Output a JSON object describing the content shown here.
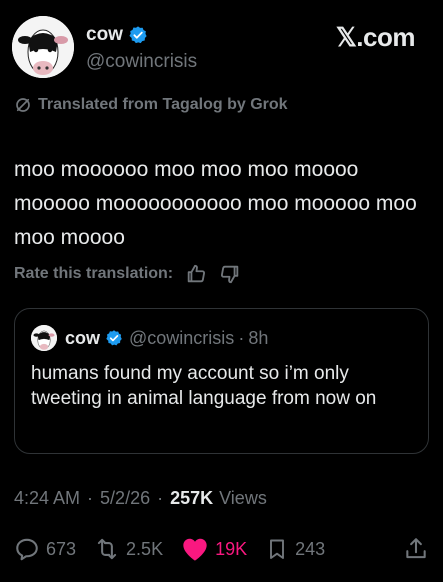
{
  "author": {
    "name": "cow",
    "handle": "@cowincrisis"
  },
  "brand": "𝕏.com",
  "translation_note": "Translated from Tagalog by Grok",
  "tweet_text": "moo moooooo moo moo moo moooo mooooo mooooooooooo moo mooooo moo moo moooo",
  "rate_label": "Rate this translation:",
  "quoted": {
    "name": "cow",
    "handle": "@cowincrisis",
    "separator": "·",
    "time": "8h",
    "text": "humans found my account so i’m only tweeting in animal language from now on"
  },
  "meta": {
    "time": "4:24 AM",
    "date": "5/2/26",
    "views_count": "257K",
    "views_label": "Views",
    "separator": "·"
  },
  "actions": {
    "replies": "673",
    "reposts": "2.5K",
    "likes": "19K",
    "bookmarks": "243"
  },
  "colors": {
    "background": "#000000",
    "text": "#e7e9ea",
    "muted": "#71767b",
    "verified": "#1d9bf0",
    "like": "#f91880",
    "border": "#2f3336"
  },
  "icons": [
    "verified-badge-icon",
    "translate-icon",
    "thumbs-up-icon",
    "thumbs-down-icon",
    "reply-icon",
    "repost-icon",
    "heart-icon",
    "bookmark-icon",
    "share-icon"
  ]
}
